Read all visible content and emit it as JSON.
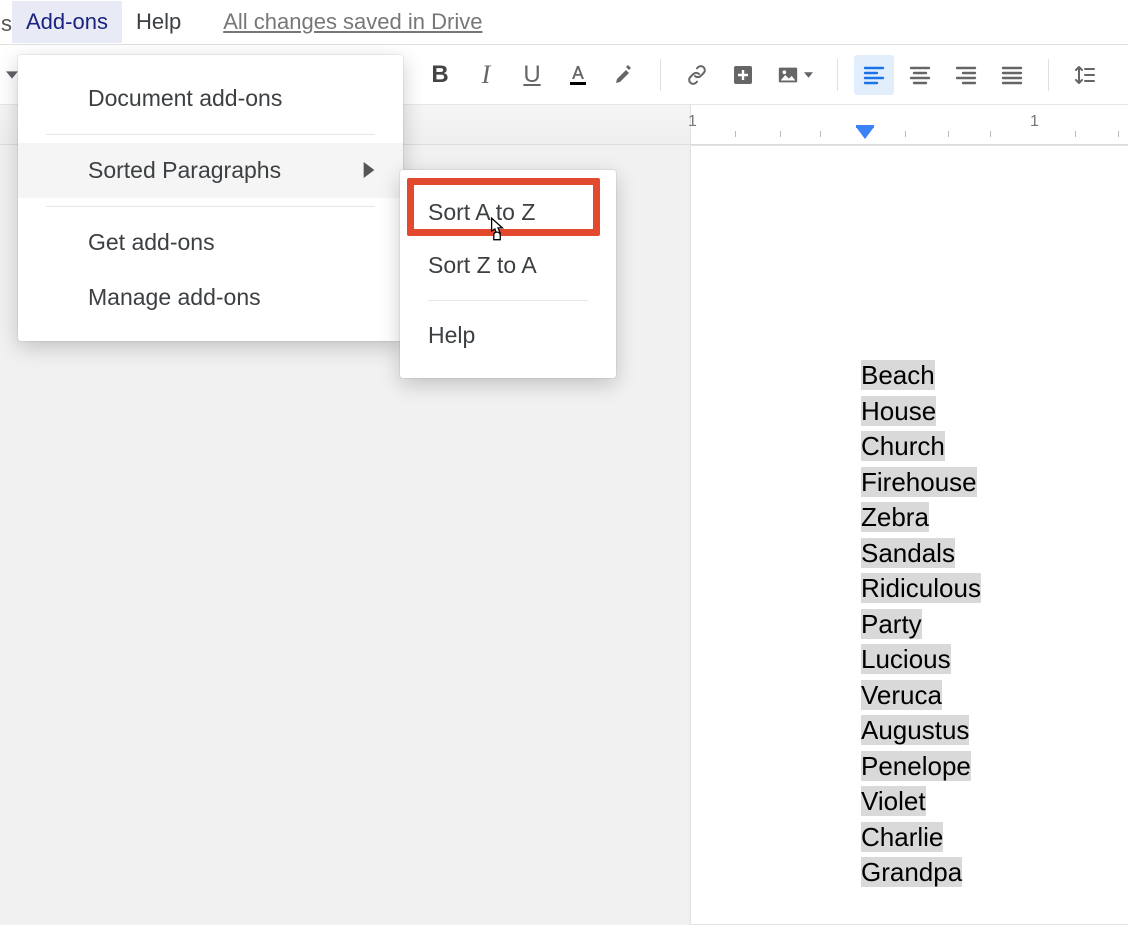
{
  "menubar": {
    "cut_letter": "s",
    "addons": "Add-ons",
    "help": "Help",
    "save_status": "All changes saved in Drive"
  },
  "ruler": {
    "tick_left": "1",
    "tick_right": "1"
  },
  "dropdown_addons": {
    "document_addons": "Document add-ons",
    "sorted_paragraphs": "Sorted Paragraphs",
    "get_addons": "Get add-ons",
    "manage_addons": "Manage add-ons"
  },
  "dropdown_sorted": {
    "sort_az": "Sort A to Z",
    "sort_za": "Sort Z to A",
    "help": "Help"
  },
  "document_lines": [
    "Beach",
    "House",
    "Church",
    "Firehouse",
    "Zebra",
    "Sandals",
    "Ridiculous",
    "Party",
    "Lucious",
    "Veruca",
    "Augustus",
    "Penelope",
    "Violet",
    "Charlie",
    "Grandpa"
  ]
}
